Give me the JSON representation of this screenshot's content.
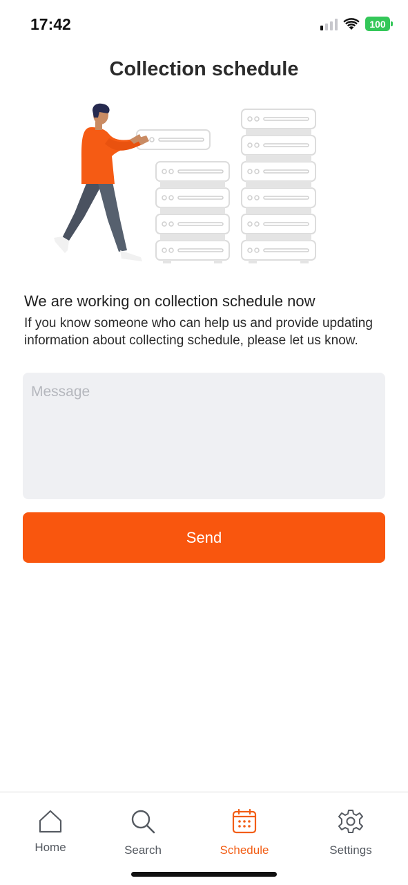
{
  "status_bar": {
    "time": "17:42",
    "battery": "100",
    "icons": [
      "signal-icon",
      "wifi-icon",
      "battery-icon"
    ]
  },
  "page": {
    "title": "Collection schedule"
  },
  "illustration": {
    "icon": "person-with-server-racks-illustration"
  },
  "content": {
    "heading": "We are working on collection schedule now",
    "body": "If you know someone who can help us and provide updating information about collecting schedule, please let us know."
  },
  "form": {
    "message_placeholder": "Message",
    "message_value": "",
    "send_label": "Send"
  },
  "tab_bar": {
    "tabs": [
      {
        "label": "Home",
        "icon": "home-icon",
        "active": false
      },
      {
        "label": "Search",
        "icon": "search-icon",
        "active": false
      },
      {
        "label": "Schedule",
        "icon": "calendar-icon",
        "active": true
      },
      {
        "label": "Settings",
        "icon": "gear-icon",
        "active": false
      }
    ]
  },
  "colors": {
    "accent": "#f9560e",
    "active_tab": "#f25d14",
    "inactive_tab": "#555a61",
    "input_background": "#eff0f3",
    "battery": "#34c759"
  }
}
